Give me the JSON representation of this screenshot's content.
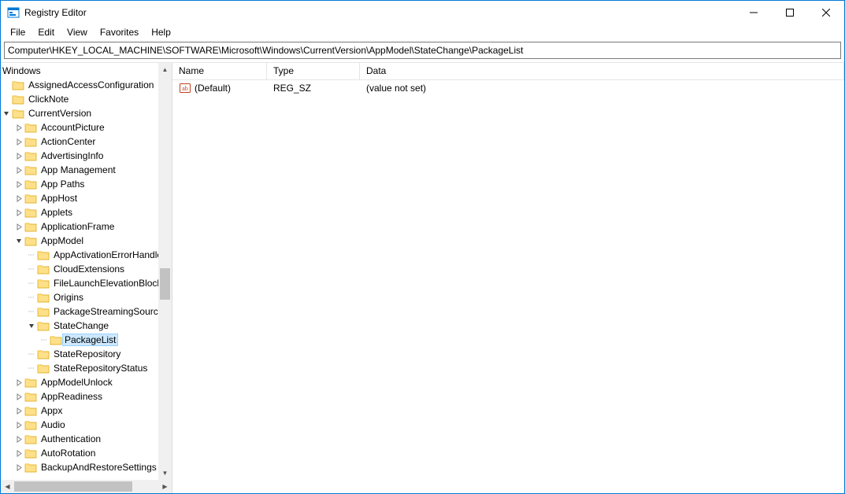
{
  "titlebar": {
    "title": "Registry Editor"
  },
  "menu": {
    "file": "File",
    "edit": "Edit",
    "view": "View",
    "favorites": "Favorites",
    "help": "Help"
  },
  "address": {
    "path": "Computer\\HKEY_LOCAL_MACHINE\\SOFTWARE\\Microsoft\\Windows\\CurrentVersion\\AppModel\\StateChange\\PackageList"
  },
  "tree_header": "Windows",
  "tree": {
    "level1": [
      {
        "label": "AssignedAccessConfiguration",
        "exp": "none"
      },
      {
        "label": "ClickNote",
        "exp": "none"
      },
      {
        "label": "CurrentVersion",
        "exp": "open"
      }
    ],
    "cv_children": [
      {
        "label": "AccountPicture",
        "exp": "closed"
      },
      {
        "label": "ActionCenter",
        "exp": "closed"
      },
      {
        "label": "AdvertisingInfo",
        "exp": "closed"
      },
      {
        "label": "App Management",
        "exp": "closed"
      },
      {
        "label": "App Paths",
        "exp": "closed"
      },
      {
        "label": "AppHost",
        "exp": "closed"
      },
      {
        "label": "Applets",
        "exp": "closed"
      },
      {
        "label": "ApplicationFrame",
        "exp": "closed"
      },
      {
        "label": "AppModel",
        "exp": "open"
      }
    ],
    "appmodel_children": [
      {
        "label": "AppActivationErrorHandlers",
        "exp": "none"
      },
      {
        "label": "CloudExtensions",
        "exp": "none"
      },
      {
        "label": "FileLaunchElevationBlockList",
        "exp": "none"
      },
      {
        "label": "Origins",
        "exp": "none"
      },
      {
        "label": "PackageStreamingSources",
        "exp": "none"
      },
      {
        "label": "StateChange",
        "exp": "open"
      }
    ],
    "statechange_children": [
      {
        "label": "PackageList",
        "exp": "none",
        "selected": true
      }
    ],
    "appmodel_after": [
      {
        "label": "StateRepository",
        "exp": "none"
      },
      {
        "label": "StateRepositoryStatus",
        "exp": "none"
      }
    ],
    "cv_after": [
      {
        "label": "AppModelUnlock",
        "exp": "closed"
      },
      {
        "label": "AppReadiness",
        "exp": "closed"
      },
      {
        "label": "Appx",
        "exp": "closed"
      },
      {
        "label": "Audio",
        "exp": "closed"
      },
      {
        "label": "Authentication",
        "exp": "closed"
      },
      {
        "label": "AutoRotation",
        "exp": "closed"
      },
      {
        "label": "BackupAndRestoreSettings",
        "exp": "closed"
      }
    ]
  },
  "list": {
    "headers": {
      "name": "Name",
      "type": "Type",
      "data": "Data"
    },
    "rows": [
      {
        "name": "(Default)",
        "type": "REG_SZ",
        "data": "(value not set)"
      }
    ]
  }
}
